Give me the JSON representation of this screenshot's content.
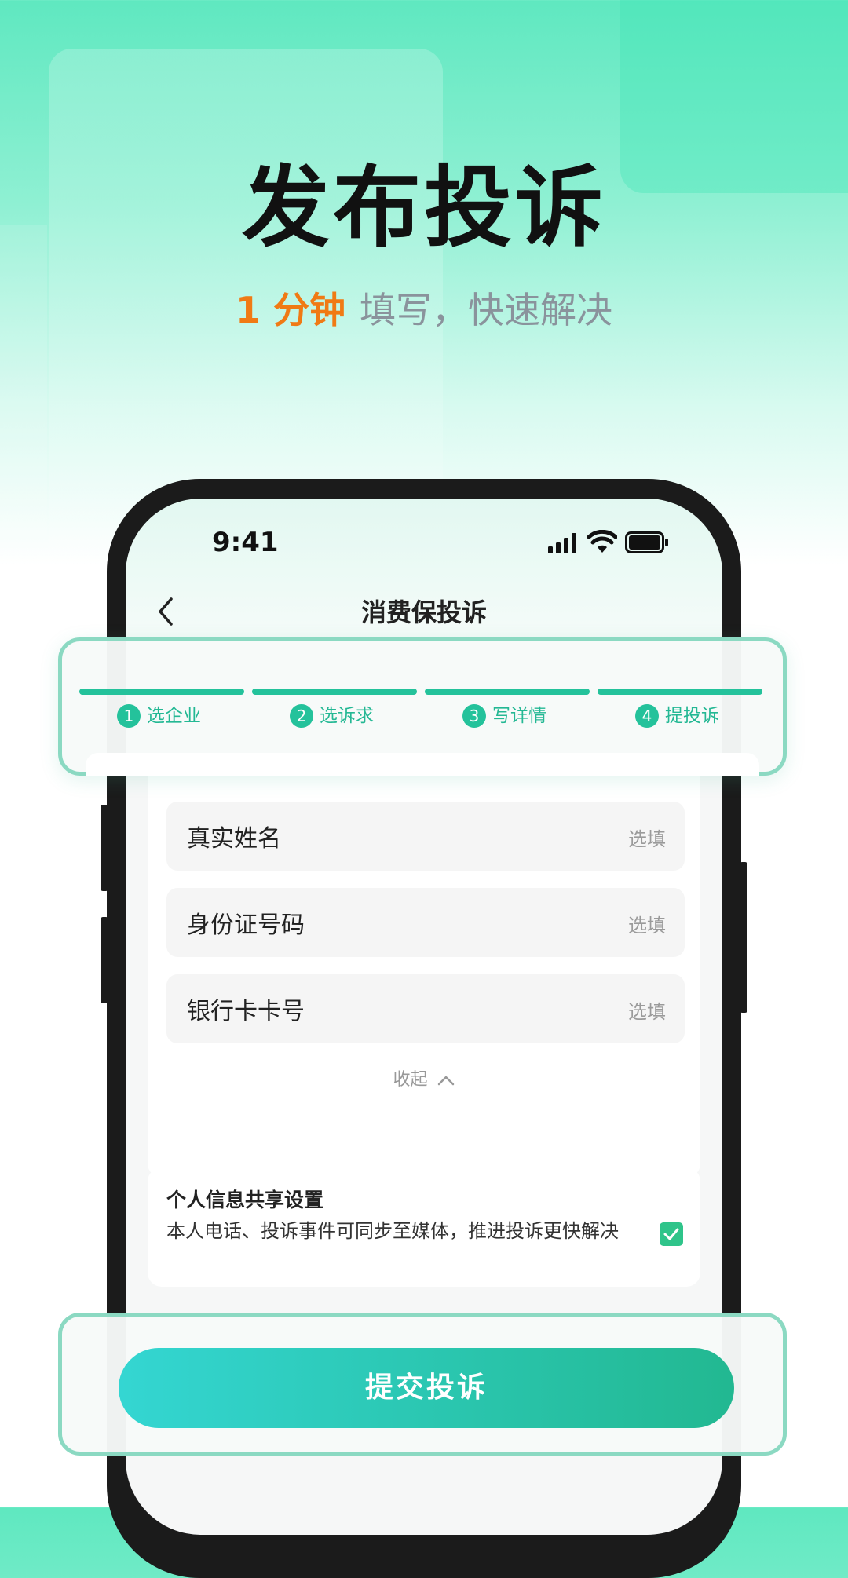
{
  "hero": {
    "title": "发布投诉",
    "subtitle_accent": "1 分钟",
    "subtitle_rest": "填写，快速解决"
  },
  "status_bar": {
    "time": "9:41"
  },
  "nav": {
    "title": "消费保投诉"
  },
  "steps": [
    {
      "num": "1",
      "label": "选企业"
    },
    {
      "num": "2",
      "label": "选诉求"
    },
    {
      "num": "3",
      "label": "写详情"
    },
    {
      "num": "4",
      "label": "提投诉"
    }
  ],
  "form": {
    "fields": [
      {
        "label": "真实姓名",
        "hint": "选填"
      },
      {
        "label": "身份证号码",
        "hint": "选填"
      },
      {
        "label": "银行卡卡号",
        "hint": "选填"
      }
    ],
    "collapse_label": "收起"
  },
  "sharing": {
    "title": "个人信息共享设置",
    "description": "本人电话、投诉事件可同步至媒体，推进投诉更快解决",
    "checked": true
  },
  "submit": {
    "label": "提交投诉"
  },
  "colors": {
    "accent": "#24c29b",
    "orange": "#f07a14"
  }
}
